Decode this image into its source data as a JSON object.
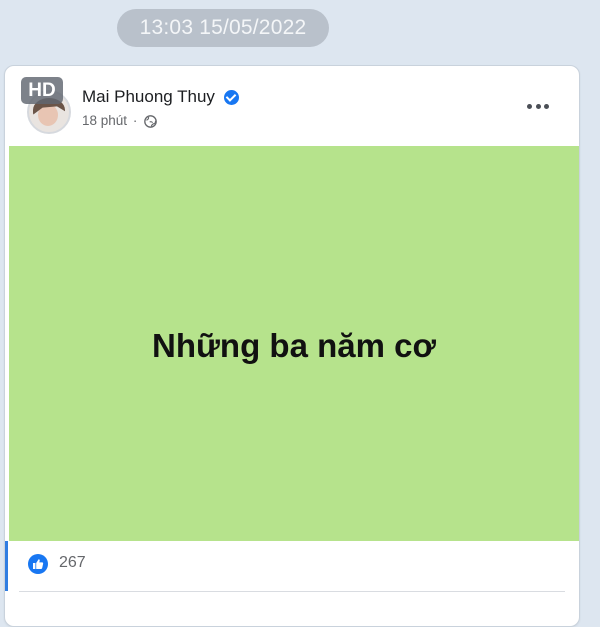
{
  "timestamp": "13:03 15/05/2022",
  "post": {
    "author": "Mai Phuong Thuy",
    "time": "18 phút",
    "separator": "·",
    "hd_badge": "HD",
    "text": "Những ba năm cơ",
    "like_count": "267"
  },
  "icons": {
    "verified": "verified-badge-icon",
    "globe": "globe-icon",
    "more": "more-options-icon",
    "like": "like-thumb-icon"
  },
  "colors": {
    "chat_background": "#dde6f0",
    "post_image_background": "#b6e38c",
    "facebook_blue": "#1877f2"
  }
}
